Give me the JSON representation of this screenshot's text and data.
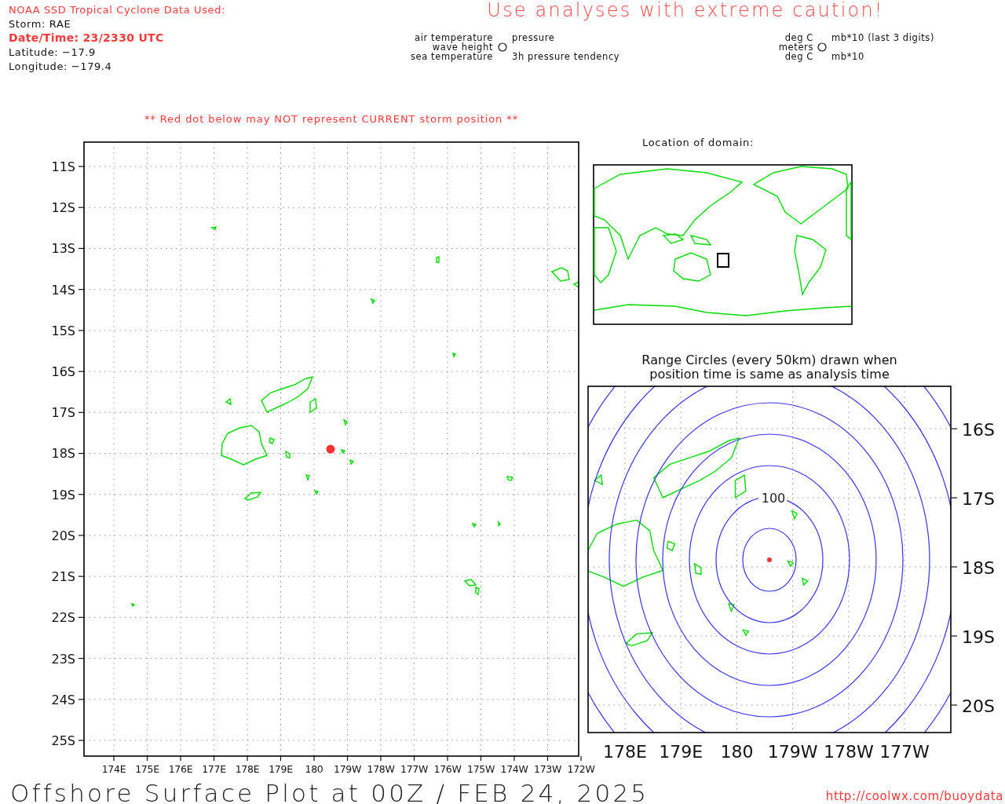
{
  "header": {
    "lines": [
      {
        "kind": "source",
        "text": "NOAA SSD Tropical Cyclone Data Used:"
      },
      {
        "kind": "info",
        "text": "Storm: RAE"
      },
      {
        "kind": "alert",
        "text": "Date/Time: 23/2330 UTC"
      },
      {
        "kind": "info",
        "text": "Latitude: −17.9"
      },
      {
        "kind": "info",
        "text": "Longitude: −179.4"
      }
    ]
  },
  "caution": "Use analyses with extreme caution!",
  "station_legend": {
    "left": [
      "air temperature",
      "wave height",
      "sea temperature"
    ],
    "right": [
      "pressure",
      "3h pressure tendency"
    ]
  },
  "units_legend": {
    "left": [
      "deg C",
      "meters",
      "deg C"
    ],
    "right": [
      "mb*10 (last 3 digits)",
      "mb*10"
    ]
  },
  "warning": "** Red dot below may NOT represent CURRENT storm position **",
  "main_map": {
    "lat_labels": [
      "11S",
      "12S",
      "13S",
      "14S",
      "15S",
      "16S",
      "17S",
      "18S",
      "19S",
      "20S",
      "21S",
      "22S",
      "23S",
      "24S",
      "25S"
    ],
    "lon_labels": [
      "174E",
      "175E",
      "176E",
      "177E",
      "178E",
      "179E",
      "180",
      "179W",
      "178W",
      "177W",
      "176W",
      "175W",
      "174W",
      "173W",
      "172W"
    ]
  },
  "domain_map": {
    "title": "Location of domain:"
  },
  "range_map": {
    "title_lines": [
      "Range Circles (every 50km) drawn when",
      "position time is same as analysis time"
    ],
    "circle_label": "100",
    "lat_labels": [
      "16S",
      "17S",
      "18S",
      "19S",
      "20S"
    ],
    "lon_labels": [
      "178E",
      "179E",
      "180",
      "179W",
      "178W",
      "177W"
    ]
  },
  "footer": {
    "title": "Offshore Surface Plot at 00Z / FEB 24, 2025",
    "url": "http://coolwx.com/buoydata"
  }
}
